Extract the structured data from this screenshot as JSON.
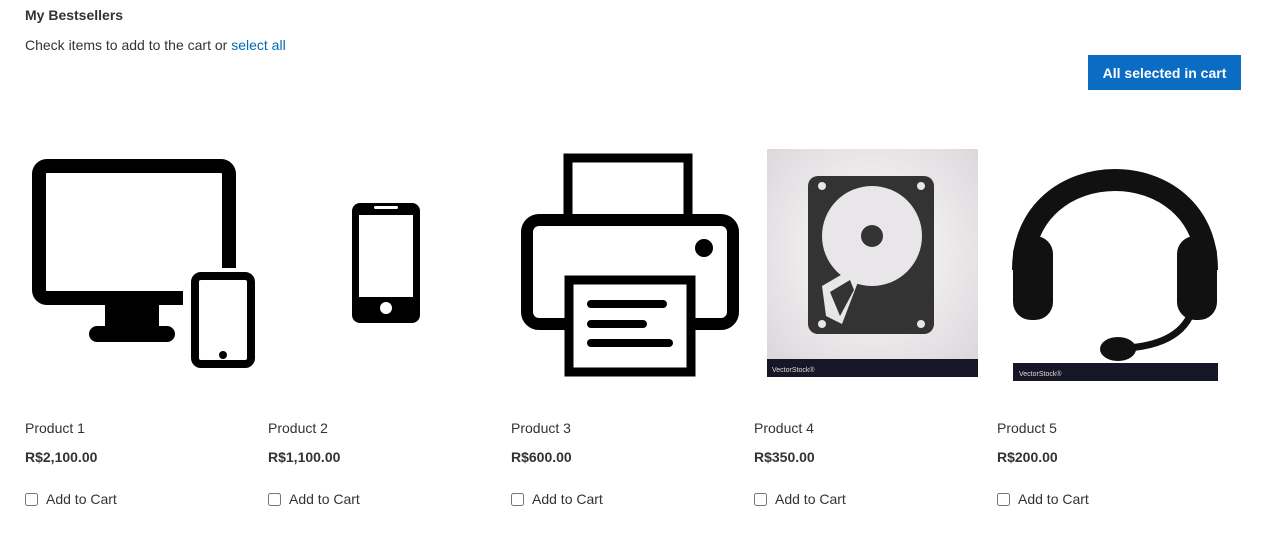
{
  "header": {
    "title": "My Bestsellers",
    "subtitle_prefix": "Check items to add to the cart or ",
    "select_all_label": "select all",
    "all_selected_label": "All selected in cart"
  },
  "products": [
    {
      "name": "Product 1",
      "price": "R$2,100.00",
      "add_label": "Add to Cart",
      "icon": "desktop-and-phone-icon"
    },
    {
      "name": "Product 2",
      "price": "R$1,100.00",
      "add_label": "Add to Cart",
      "icon": "smartphone-icon"
    },
    {
      "name": "Product 3",
      "price": "R$600.00",
      "add_label": "Add to Cart",
      "icon": "printer-icon"
    },
    {
      "name": "Product 4",
      "price": "R$350.00",
      "add_label": "Add to Cart",
      "icon": "hard-drive-icon",
      "watermark": "VectorStock®"
    },
    {
      "name": "Product 5",
      "price": "R$200.00",
      "add_label": "Add to Cart",
      "icon": "headset-icon",
      "watermark": "VectorStock®"
    }
  ]
}
